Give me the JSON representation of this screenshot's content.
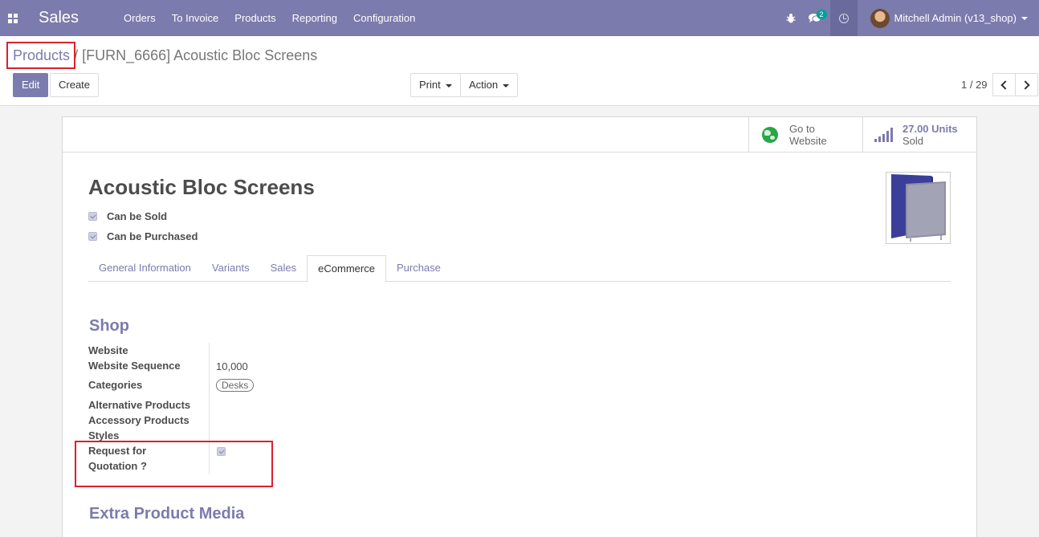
{
  "navbar": {
    "app_name": "Sales",
    "menu": [
      "Orders",
      "To Invoice",
      "Products",
      "Reporting",
      "Configuration"
    ],
    "messages_badge": "2",
    "user_name": "Mitchell Admin (v13_shop)"
  },
  "breadcrumb": {
    "parent": "Products",
    "separator": "/",
    "current": "[FURN_6666] Acoustic Bloc Screens"
  },
  "toolbar": {
    "edit_label": "Edit",
    "create_label": "Create",
    "print_label": "Print",
    "action_label": "Action",
    "pager": "1 / 29"
  },
  "smart_buttons": {
    "website_line1": "Go to",
    "website_line2": "Website",
    "sold_value": "27.00 Units",
    "sold_label": "Sold"
  },
  "product": {
    "name": "Acoustic Bloc Screens",
    "can_be_sold_label": "Can be Sold",
    "can_be_purchased_label": "Can be Purchased"
  },
  "tabs": [
    "General Information",
    "Variants",
    "Sales",
    "eCommerce",
    "Purchase"
  ],
  "active_tab": "eCommerce",
  "shop": {
    "title": "Shop",
    "website_label": "Website",
    "sequence_label": "Website Sequence",
    "sequence_value": "10,000",
    "categories_label": "Categories",
    "category_tag": "Desks",
    "alternative_label": "Alternative Products",
    "accessory_label": "Accessory Products",
    "styles_label": "Styles",
    "rfq_label_line1": "Request for",
    "rfq_label_line2": "Quotation ?"
  },
  "extra_media": {
    "title": "Extra Product Media"
  },
  "colors": {
    "brand": "#7c7bad",
    "highlight": "#d9212c",
    "badge": "#00a09d",
    "globe": "#28a745"
  }
}
